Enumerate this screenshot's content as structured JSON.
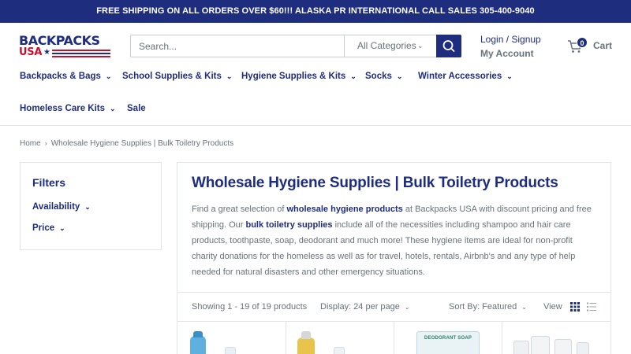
{
  "announcement": "FREE SHIPPING ON ALL ORDERS OVER $60!!! ALASKA PR INTERNATIONAL CALL SALES 305-400-9040",
  "logo": {
    "line1": "BACKPACKS",
    "line2": "USA"
  },
  "search": {
    "placeholder": "Search...",
    "category": "All Categories"
  },
  "account": {
    "login": "Login / Signup",
    "my_account": "My Account"
  },
  "cart": {
    "count": "0",
    "label": "Cart"
  },
  "nav": [
    {
      "label": "Backpacks & Bags"
    },
    {
      "label": "School Supplies & Kits"
    },
    {
      "label": "Hygiene Supplies & Kits"
    },
    {
      "label": "Socks"
    },
    {
      "label": "Winter Accessories"
    },
    {
      "label": "Homeless Care Kits"
    },
    {
      "label": "Sale"
    }
  ],
  "breadcrumb": {
    "home": "Home",
    "current": "Wholesale Hygiene Supplies | Bulk Toiletry Products"
  },
  "filters": {
    "title": "Filters",
    "availability": "Availability",
    "price": "Price"
  },
  "collection": {
    "title": "Wholesale Hygiene Supplies | Bulk Toiletry Products",
    "desc_1": "Find a great selection of ",
    "desc_b1": "wholesale hygiene products",
    "desc_2": " at Backpacks USA with discount pricing and free shipping. Our ",
    "desc_b2": "bulk toiletry supplies",
    "desc_3": " include all of the necessities including shampoo and hair care products, toothpaste, soap, deodorant and much more! These hygiene items are ideal for non-profit charity donations for the homeless as well as for travel, hotels, rentals, Airbnb's and any type of help needed for natural disasters and other emergency situations."
  },
  "toolbar": {
    "showing": "Showing 1 - 19 of 19 products",
    "display": "Display: 24 per page",
    "sort": "Sort By: Featured",
    "view": "View"
  },
  "products": [
    {
      "image_label": ""
    },
    {
      "image_label": ""
    },
    {
      "image_label": "DEODORANT SOAP"
    },
    {
      "image_label": ""
    }
  ],
  "colors": {
    "brand": "#1e2d7d",
    "accent": "#c8102e",
    "text_muted": "#677279"
  }
}
